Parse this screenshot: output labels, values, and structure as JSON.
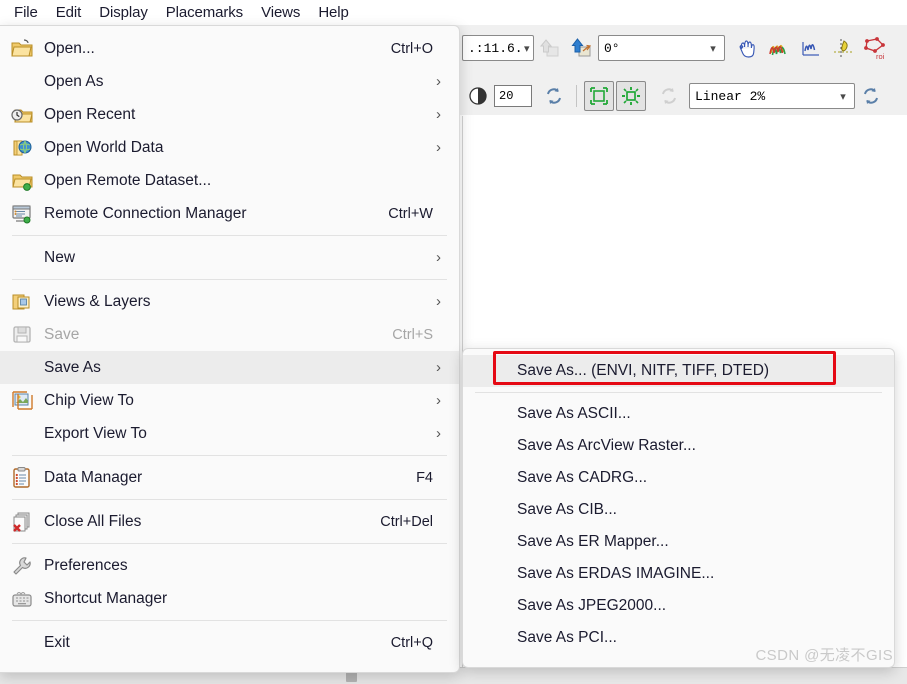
{
  "menubar": {
    "items": [
      {
        "label": "File",
        "active": true
      },
      {
        "label": "Edit",
        "active": false
      },
      {
        "label": "Display",
        "active": false
      },
      {
        "label": "Placemarks",
        "active": false
      },
      {
        "label": "Views",
        "active": false
      },
      {
        "label": "Help",
        "active": false
      }
    ]
  },
  "toolbar": {
    "row1": {
      "zoom_combo_value": ".:11.6.",
      "up_arrow_icon": "move-layer-up-icon",
      "up_arrow_blue_icon": "move-layer-up-active-icon",
      "rotation_combo_value": "0°",
      "pan_icon": "pan-hand-icon",
      "spectral_profile_icon": "spectral-profile-icon",
      "multi_spectral_icon": "multi-spectral-profile-icon",
      "scatter_icon": "scatter-plot-icon",
      "roi_icon": "roi-tool-icon"
    },
    "row2": {
      "contrast_icon": "contrast-icon",
      "brightness_value": "20",
      "refresh_icon": "refresh-icon",
      "full_extent_icon": "stretch-full-extent-icon",
      "view_extent_icon": "stretch-view-extent-icon",
      "rotate_icon": "rotate-reset-icon",
      "stretch_combo_value": "Linear 2%",
      "refresh2_icon": "refresh-stretch-icon"
    }
  },
  "file_menu": {
    "items": [
      {
        "type": "item",
        "label": "Open...",
        "accel": "Ctrl+O",
        "icon": "open-folder-icon",
        "submenu": false,
        "disabled": false,
        "highlight": false
      },
      {
        "type": "item",
        "label": "Open As",
        "accel": "",
        "icon": "",
        "submenu": true,
        "disabled": false,
        "highlight": false
      },
      {
        "type": "item",
        "label": "Open Recent",
        "accel": "",
        "icon": "open-recent-icon",
        "submenu": true,
        "disabled": false,
        "highlight": false
      },
      {
        "type": "item",
        "label": "Open World Data",
        "accel": "",
        "icon": "open-world-data-icon",
        "submenu": true,
        "disabled": false,
        "highlight": false
      },
      {
        "type": "item",
        "label": "Open Remote Dataset...",
        "accel": "",
        "icon": "open-remote-dataset-icon",
        "submenu": false,
        "disabled": false,
        "highlight": false
      },
      {
        "type": "item",
        "label": "Remote Connection Manager",
        "accel": "Ctrl+W",
        "icon": "remote-connection-icon",
        "submenu": false,
        "disabled": false,
        "highlight": false
      },
      {
        "type": "separator"
      },
      {
        "type": "item",
        "label": "New",
        "accel": "",
        "icon": "",
        "submenu": true,
        "disabled": false,
        "highlight": false
      },
      {
        "type": "separator"
      },
      {
        "type": "item",
        "label": "Views & Layers",
        "accel": "",
        "icon": "views-layers-icon",
        "submenu": true,
        "disabled": false,
        "highlight": false
      },
      {
        "type": "item",
        "label": "Save",
        "accel": "Ctrl+S",
        "icon": "save-disk-icon",
        "submenu": false,
        "disabled": true,
        "highlight": false
      },
      {
        "type": "item",
        "label": "Save As",
        "accel": "",
        "icon": "",
        "submenu": true,
        "disabled": false,
        "highlight": true
      },
      {
        "type": "item",
        "label": "Chip View To",
        "accel": "",
        "icon": "chip-view-icon",
        "submenu": true,
        "disabled": false,
        "highlight": false
      },
      {
        "type": "item",
        "label": "Export View To",
        "accel": "",
        "icon": "",
        "submenu": true,
        "disabled": false,
        "highlight": false
      },
      {
        "type": "separator"
      },
      {
        "type": "item",
        "label": "Data Manager",
        "accel": "F4",
        "icon": "data-manager-icon",
        "submenu": false,
        "disabled": false,
        "highlight": false
      },
      {
        "type": "separator"
      },
      {
        "type": "item",
        "label": "Close All Files",
        "accel": "Ctrl+Del",
        "icon": "close-all-files-icon",
        "submenu": false,
        "disabled": false,
        "highlight": false
      },
      {
        "type": "separator"
      },
      {
        "type": "item",
        "label": "Preferences",
        "accel": "",
        "icon": "preferences-wrench-icon",
        "submenu": false,
        "disabled": false,
        "highlight": false
      },
      {
        "type": "item",
        "label": "Shortcut Manager",
        "accel": "",
        "icon": "shortcut-manager-icon",
        "submenu": false,
        "disabled": false,
        "highlight": false
      },
      {
        "type": "separator"
      },
      {
        "type": "item",
        "label": "Exit",
        "accel": "Ctrl+Q",
        "icon": "",
        "submenu": false,
        "disabled": false,
        "highlight": false
      }
    ]
  },
  "save_as_submenu": {
    "items": [
      {
        "type": "item",
        "label": "Save As... (ENVI, NITF, TIFF, DTED)",
        "highlight": true
      },
      {
        "type": "separator"
      },
      {
        "type": "item",
        "label": "Save As ASCII...",
        "highlight": false
      },
      {
        "type": "item",
        "label": "Save As ArcView Raster...",
        "highlight": false
      },
      {
        "type": "item",
        "label": "Save As CADRG...",
        "highlight": false
      },
      {
        "type": "item",
        "label": "Save As CIB...",
        "highlight": false
      },
      {
        "type": "item",
        "label": "Save As ER Mapper...",
        "highlight": false
      },
      {
        "type": "item",
        "label": "Save As ERDAS IMAGINE...",
        "highlight": false
      },
      {
        "type": "item",
        "label": "Save As JPEG2000...",
        "highlight": false
      },
      {
        "type": "item",
        "label": "Save As PCI...",
        "highlight": false
      }
    ]
  },
  "annotation": {
    "highlight_color": "#e50914",
    "target_label": "Save As... (ENVI, NITF, TIFF, DTED)"
  },
  "watermark": {
    "text": "CSDN @无凌不GIS"
  }
}
